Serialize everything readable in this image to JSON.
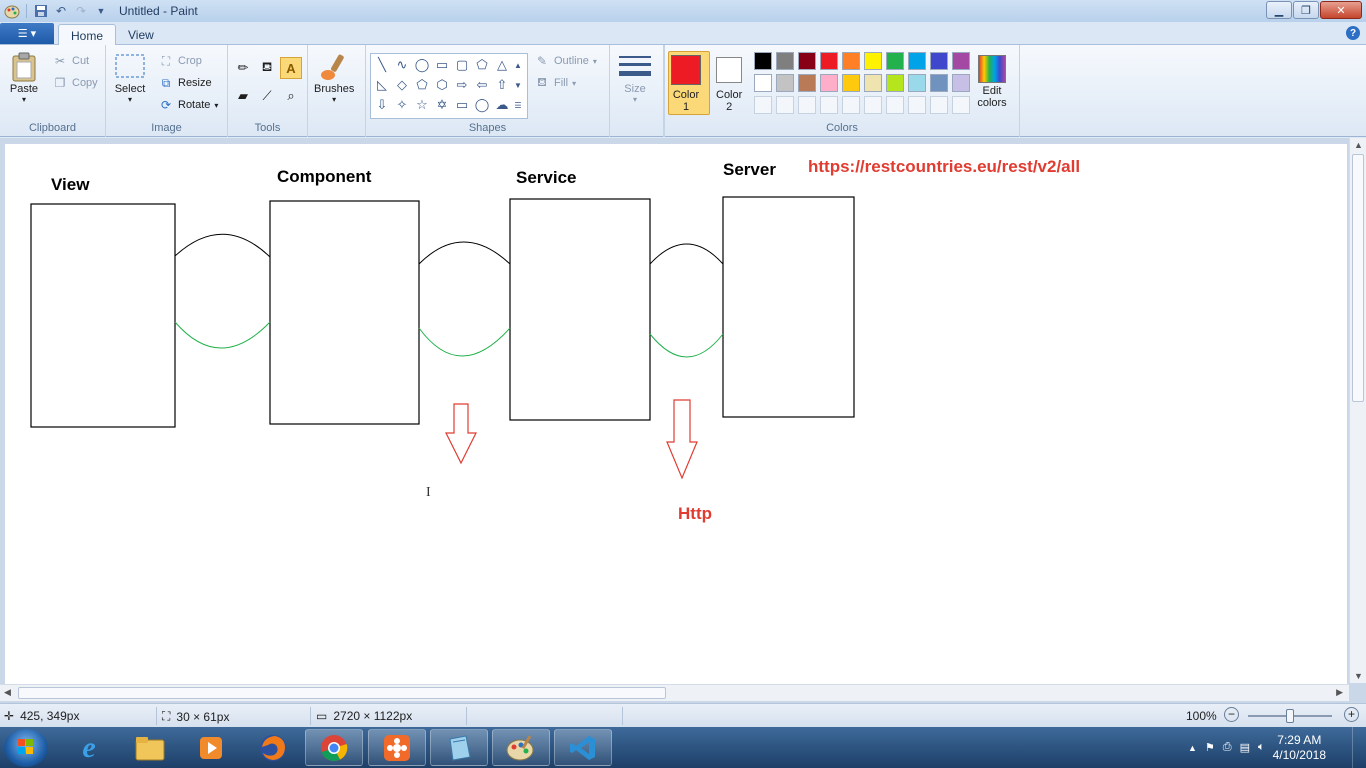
{
  "window": {
    "title": "Untitled - Paint"
  },
  "tabs": [
    {
      "label": "Home"
    },
    {
      "label": "View"
    }
  ],
  "ribbon": {
    "clipboard": {
      "label": "Clipboard",
      "paste": "Paste",
      "cut": "Cut",
      "copy": "Copy"
    },
    "image": {
      "label": "Image",
      "select": "Select",
      "crop": "Crop",
      "resize": "Resize",
      "rotate": "Rotate"
    },
    "tools": {
      "label": "Tools"
    },
    "brushes": {
      "label": "Brushes"
    },
    "shapes": {
      "label": "Shapes",
      "outline": "Outline",
      "fill": "Fill"
    },
    "size": {
      "label": "Size"
    },
    "colors": {
      "label": "Colors",
      "color1": {
        "label": "Color",
        "num": "1",
        "value": "#ed1c24"
      },
      "color2": {
        "label": "Color",
        "num": "2",
        "value": "#ffffff"
      },
      "edit": {
        "line1": "Edit",
        "line2": "colors"
      },
      "palette_row1": [
        "#000000",
        "#7f7f7f",
        "#880015",
        "#ed1c24",
        "#ff7f27",
        "#fff200",
        "#22b14c",
        "#00a2e8",
        "#3f48cc",
        "#a349a4"
      ],
      "palette_row2": [
        "#ffffff",
        "#c3c3c3",
        "#b97a57",
        "#ffaec9",
        "#ffc90e",
        "#efe4b0",
        "#b5e61d",
        "#99d9ea",
        "#7092be",
        "#c8bfe7"
      ]
    }
  },
  "drawing": {
    "labels": {
      "view": "View",
      "component": "Component",
      "service": "Service",
      "server": "Server"
    },
    "url": "https://restcountries.eu/rest/v2/all",
    "http": "Http",
    "colors": {
      "black_line": "#000000",
      "green_line": "#22b14c",
      "red": "#e03c31"
    }
  },
  "status": {
    "cursor": "425, 349px",
    "selection": "30 × 61px",
    "canvas_size": "2720 × 1122px",
    "zoom": "100%"
  },
  "taskbar": {
    "time": "7:29 AM",
    "date": "4/10/2018",
    "apps": [
      "internet-explorer",
      "file-explorer",
      "media-player",
      "firefox",
      "chrome",
      "app-flower",
      "notepad",
      "paint",
      "vscode"
    ]
  }
}
